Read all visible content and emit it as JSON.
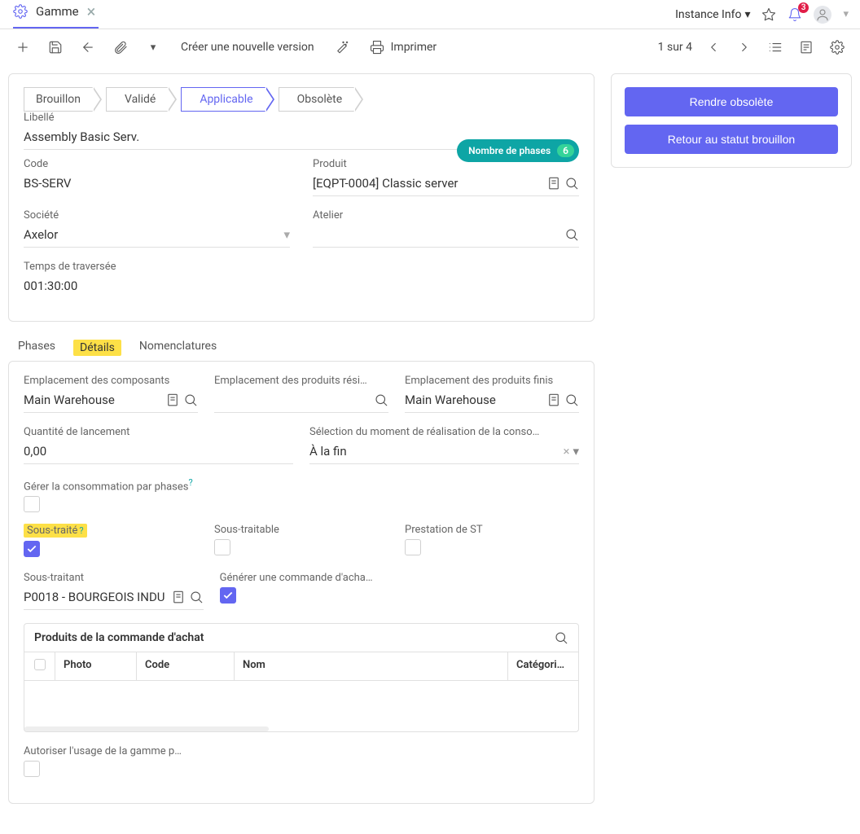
{
  "header": {
    "tab_title": "Gamme",
    "instance_label": "Instance Info",
    "notification_count": "3"
  },
  "toolbar": {
    "create_version": "Créer une nouvelle version",
    "print": "Imprimer",
    "pager": "1 sur 4"
  },
  "states": [
    "Brouillon",
    "Validé",
    "Applicable",
    "Obsolète"
  ],
  "state_active_index": 2,
  "phase_badge": {
    "label": "Nombre de phases",
    "count": "6"
  },
  "fields": {
    "libelle_label": "Libellé",
    "libelle_value": "Assembly Basic Serv.",
    "code_label": "Code",
    "code_value": "BS-SERV",
    "produit_label": "Produit",
    "produit_value": "[EQPT-0004] Classic server",
    "societe_label": "Société",
    "societe_value": "Axelor",
    "atelier_label": "Atelier",
    "atelier_value": "",
    "traversee_label": "Temps de traversée",
    "traversee_value": "001:30:00"
  },
  "subtabs": {
    "phases": "Phases",
    "details": "Détails",
    "nomenclatures": "Nomenclatures"
  },
  "details": {
    "emp_composants_label": "Emplacement des composants",
    "emp_composants_value": "Main Warehouse",
    "emp_residuels_label": "Emplacement des produits rési…",
    "emp_residuels_value": "",
    "emp_finis_label": "Emplacement des produits finis",
    "emp_finis_value": "Main Warehouse",
    "qte_label": "Quantité de lancement",
    "qte_value": "0,00",
    "moment_label": "Sélection du moment de réalisation de la conso…",
    "moment_value": "À la fin",
    "gerer_label": "Gérer la consommation par phases",
    "sous_traite_label": "Sous-traité",
    "sous_traitable_label": "Sous-traitable",
    "prestation_label": "Prestation de ST",
    "sous_traitant_label": "Sous-traitant",
    "sous_traitant_value": "P0018 - BOURGEOIS INDU",
    "generer_label": "Générer une commande d'acha…",
    "autoriser_label": "Autoriser l'usage de la gamme p…"
  },
  "nested": {
    "title": "Produits de la commande d'achat",
    "cols": {
      "photo": "Photo",
      "code": "Code",
      "nom": "Nom",
      "categorie": "Catégori…"
    }
  },
  "actions": {
    "obsolete": "Rendre obsolète",
    "retour": "Retour au statut brouillon"
  }
}
